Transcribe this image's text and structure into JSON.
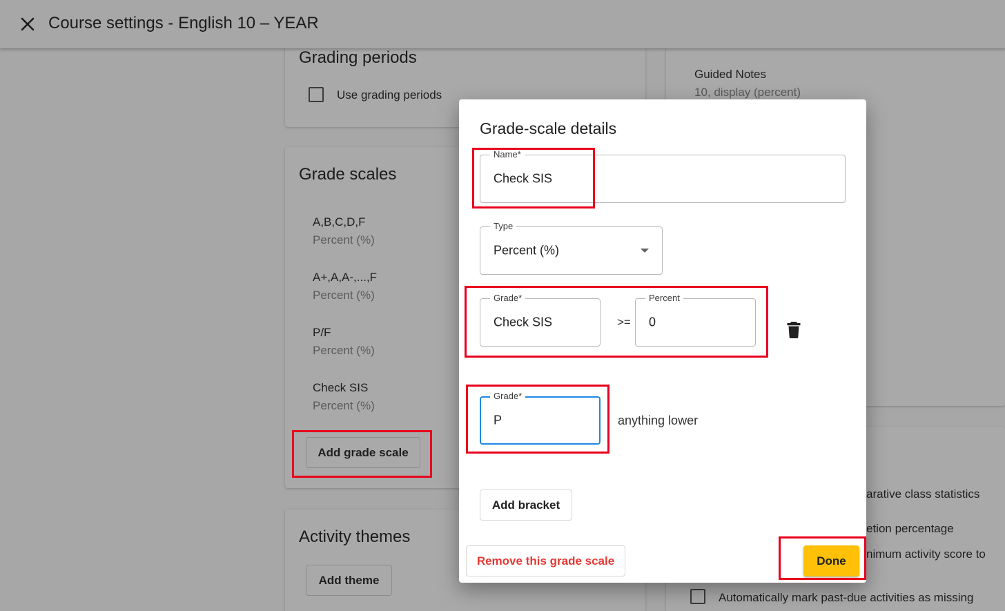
{
  "header": {
    "title": "Course settings - English 10 – YEAR",
    "close_icon": "close-icon"
  },
  "grading_periods": {
    "title": "Grading periods",
    "checkbox_label": "Use grading periods"
  },
  "grade_scales": {
    "title": "Grade scales",
    "items": [
      {
        "name": "A,B,C,D,F",
        "type": "Percent (%)"
      },
      {
        "name": "A+,A,A-,...,F",
        "type": "Percent (%)"
      },
      {
        "name": "P/F",
        "type": "Percent (%)"
      },
      {
        "name": "Check SIS",
        "type": "Percent (%)"
      }
    ],
    "add_button": "Add grade scale"
  },
  "activity_themes": {
    "title": "Activity themes",
    "add_button": "Add theme"
  },
  "right_panel": {
    "guided_notes_title": "Guided Notes",
    "guided_notes_sub": "10, display (percent)",
    "option_1": "arative class statistics",
    "option_2": "etion percentage",
    "option_3": "nimum activity score to",
    "auto_missing_label": "Automatically mark past-due activities as missing"
  },
  "dialog": {
    "title": "Grade-scale details",
    "name_label": "Name*",
    "name_value": "Check SIS",
    "type_label": "Type",
    "type_value": "Percent (%)",
    "bracket1": {
      "grade_label": "Grade*",
      "grade_value": "Check SIS",
      "operator": ">=",
      "percent_label": "Percent",
      "percent_value": "0"
    },
    "bracket2": {
      "grade_label": "Grade*",
      "grade_value": "P",
      "suffix": "anything lower"
    },
    "add_bracket": "Add bracket",
    "remove_button": "Remove this grade scale",
    "done_button": "Done"
  },
  "colors": {
    "accent": "#ffc107",
    "focus": "#1e88e5",
    "danger": "#e53935",
    "annotation": "#e8001c"
  }
}
